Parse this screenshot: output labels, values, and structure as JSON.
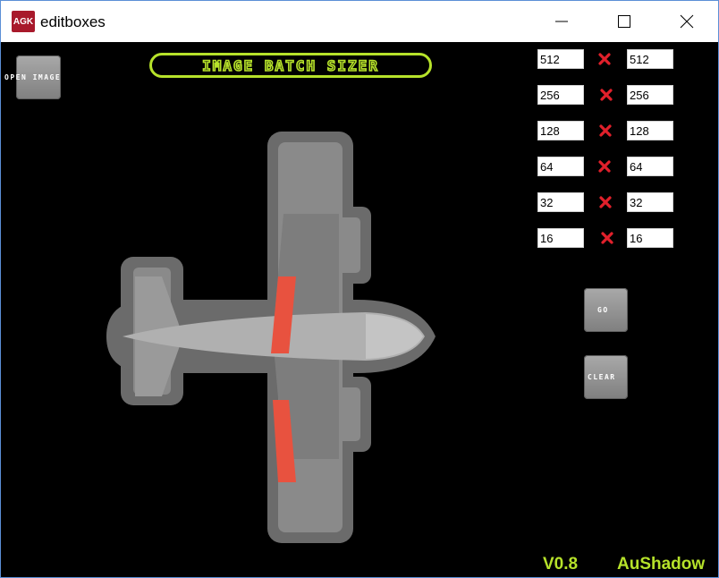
{
  "window": {
    "app_icon_text": "AGK",
    "title": "editboxes"
  },
  "app": {
    "open_image_label": "OPEN IMAGE",
    "banner_title": "IMAGE BATCH SIZER",
    "go_label": "GO",
    "clear_label": "CLEAR",
    "version": "V0.8",
    "author": "AuShadow"
  },
  "sizes": [
    {
      "width": "512",
      "height": "512"
    },
    {
      "width": "256",
      "height": "256"
    },
    {
      "width": "128",
      "height": "128"
    },
    {
      "width": "64",
      "height": "64"
    },
    {
      "width": "32",
      "height": "32"
    },
    {
      "width": "16",
      "height": "16"
    }
  ],
  "colors": {
    "accent_green": "#b6e22a",
    "x_red": "#e1202b",
    "stripe_red": "#e8523f",
    "app_icon_bg": "#a8192b"
  }
}
